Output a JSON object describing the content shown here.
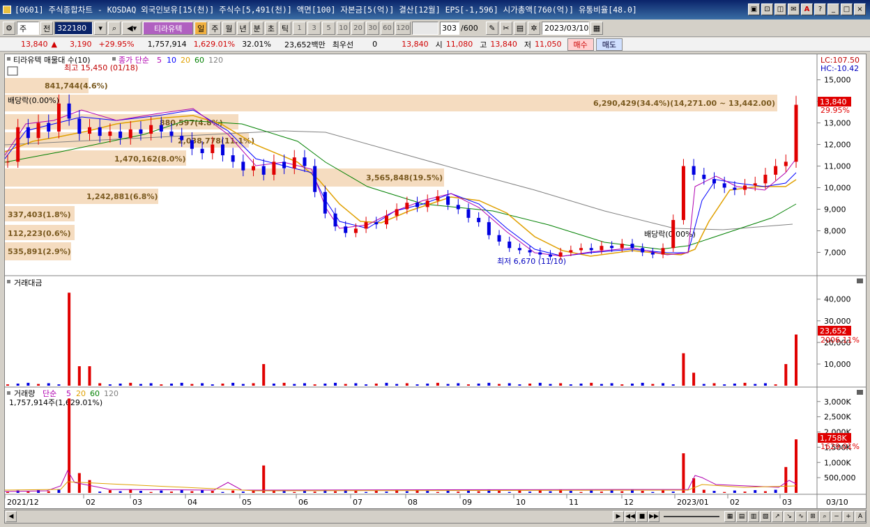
{
  "window": {
    "title": "[0601] 주식종합차트 - KOSDAQ 외국인보유[15(천)] 주식수[5,491(천)] 액면[100] 자본금[5(억)] 결산[12월] EPS[-1,596] 시가총액[760(억)] 유통비율[48.0]",
    "buttons": [
      "▣",
      "⊡",
      "◫",
      "✉",
      "A",
      "?",
      "_",
      "□",
      "×"
    ]
  },
  "toolbar": {
    "market": "주",
    "prev_label": "전",
    "code": "322180",
    "stock_name": "티라유텍",
    "periods": [
      "일",
      "주",
      "월",
      "년",
      "분",
      "초",
      "틱"
    ],
    "intervals": [
      "1",
      "3",
      "5",
      "10",
      "20",
      "30",
      "60",
      "120"
    ],
    "count": "303",
    "count_total": "/600",
    "date": "2023/03/10"
  },
  "quote": {
    "price": "13,840",
    "arrow": "▲",
    "change": "3,190",
    "change_pct": "+29.95%",
    "volume": "1,757,914",
    "volume_pct": "1,629.01%",
    "turnover": "32.01%",
    "amount": "23,652백만",
    "best_bid_label": "최우선",
    "best_bid": "0",
    "ask": "13,840",
    "open_label": "시",
    "open": "11,080",
    "high_label": "고",
    "high": "13,840",
    "low_label": "저",
    "low": "11,050",
    "buy_button": "매수",
    "sell_button": "매도"
  },
  "price_panel": {
    "legend_name": "티라유텍 매물대 수(10)",
    "legend_ma": "종가 단순",
    "ma_periods": [
      "5",
      "10",
      "20",
      "60",
      "120"
    ],
    "ma_colors": [
      "#b000b0",
      "#0000ff",
      "#e0a000",
      "#008000",
      "#808080"
    ],
    "lc": "LC:107.50",
    "hc": "HC:-10.42",
    "last_price": "13,840",
    "last_pct": "29.95%",
    "high_note": "최고 15,450 (01/18)",
    "low_note": "최저 6,670 (11/10)",
    "dividend_note_1": "배당락(0.00%)",
    "dividend_note_2": "배당락(0.00%)",
    "y_ticks": [
      "15,000",
      "14,000",
      "13,000",
      "12,000",
      "11,000",
      "10,000",
      "9,000",
      "8,000",
      "7,000"
    ],
    "volume_profile": [
      {
        "label": "841,744(4.6%)"
      },
      {
        "label": "6,290,429(34.4%)(14,271.00 ~ 13,442.00)"
      },
      {
        "label": "880,597(4.8%)"
      },
      {
        "label": "2,038,778(11.1%)"
      },
      {
        "label": "1,470,162(8.0%)"
      },
      {
        "label": "3,565,848(19.5%)"
      },
      {
        "label": "1,242,881(6.8%)"
      },
      {
        "label": "337,403(1.8%)"
      },
      {
        "label": "112,223(0.6%)"
      },
      {
        "label": "535,891(2.9%)"
      }
    ]
  },
  "amount_panel": {
    "title": "거래대금",
    "y_ticks": [
      "40,000",
      "30,000",
      "20,000",
      "10,000"
    ],
    "last_value": "23,652",
    "last_pct": "2006.11%"
  },
  "volume_panel": {
    "title": "거래량",
    "legend_ma": "단순",
    "ma_periods": [
      "5",
      "20",
      "60",
      "120"
    ],
    "summary": "1,757,914주(1,629.01%)",
    "y_ticks": [
      "3,000K",
      "2,500K",
      "2,000K",
      "1,500K",
      "1,000K",
      "500,000"
    ],
    "last_value": "1,758K",
    "last_pct": "1629.01%"
  },
  "x_axis": {
    "labels": [
      "2021/12",
      "02",
      "03",
      "04",
      "05",
      "06",
      "07",
      "08",
      "09",
      "10",
      "11",
      "12",
      "2023/01",
      "02",
      "03"
    ],
    "end_label": "03/10"
  },
  "chart_data": {
    "type": "candlestick",
    "price_range": [
      6500,
      15600
    ],
    "close_series": [
      11200,
      12800,
      12300,
      13000,
      12600,
      13900,
      13200,
      12500,
      12800,
      12400,
      12600,
      12300,
      12700,
      12500,
      12900,
      12600,
      12400,
      12200,
      11800,
      11600,
      12000,
      11500,
      11200,
      10800,
      11000,
      10600,
      11200,
      10900,
      11400,
      11000,
      9800,
      8800,
      8200,
      7900,
      8100,
      8400,
      8300,
      8700,
      9000,
      9300,
      9100,
      9400,
      9600,
      9200,
      9000,
      8600,
      8400,
      7800,
      7500,
      7200,
      7100,
      7000,
      6900,
      6800,
      7000,
      7100,
      7200,
      7100,
      7300,
      7200,
      7400,
      7200,
      7000,
      6900,
      7200,
      8500,
      11000,
      10600,
      10400,
      10200,
      10000,
      9900,
      10100,
      10200,
      10600,
      11000,
      11200,
      13840
    ],
    "volume_peak_labels": "values in volume panel"
  }
}
